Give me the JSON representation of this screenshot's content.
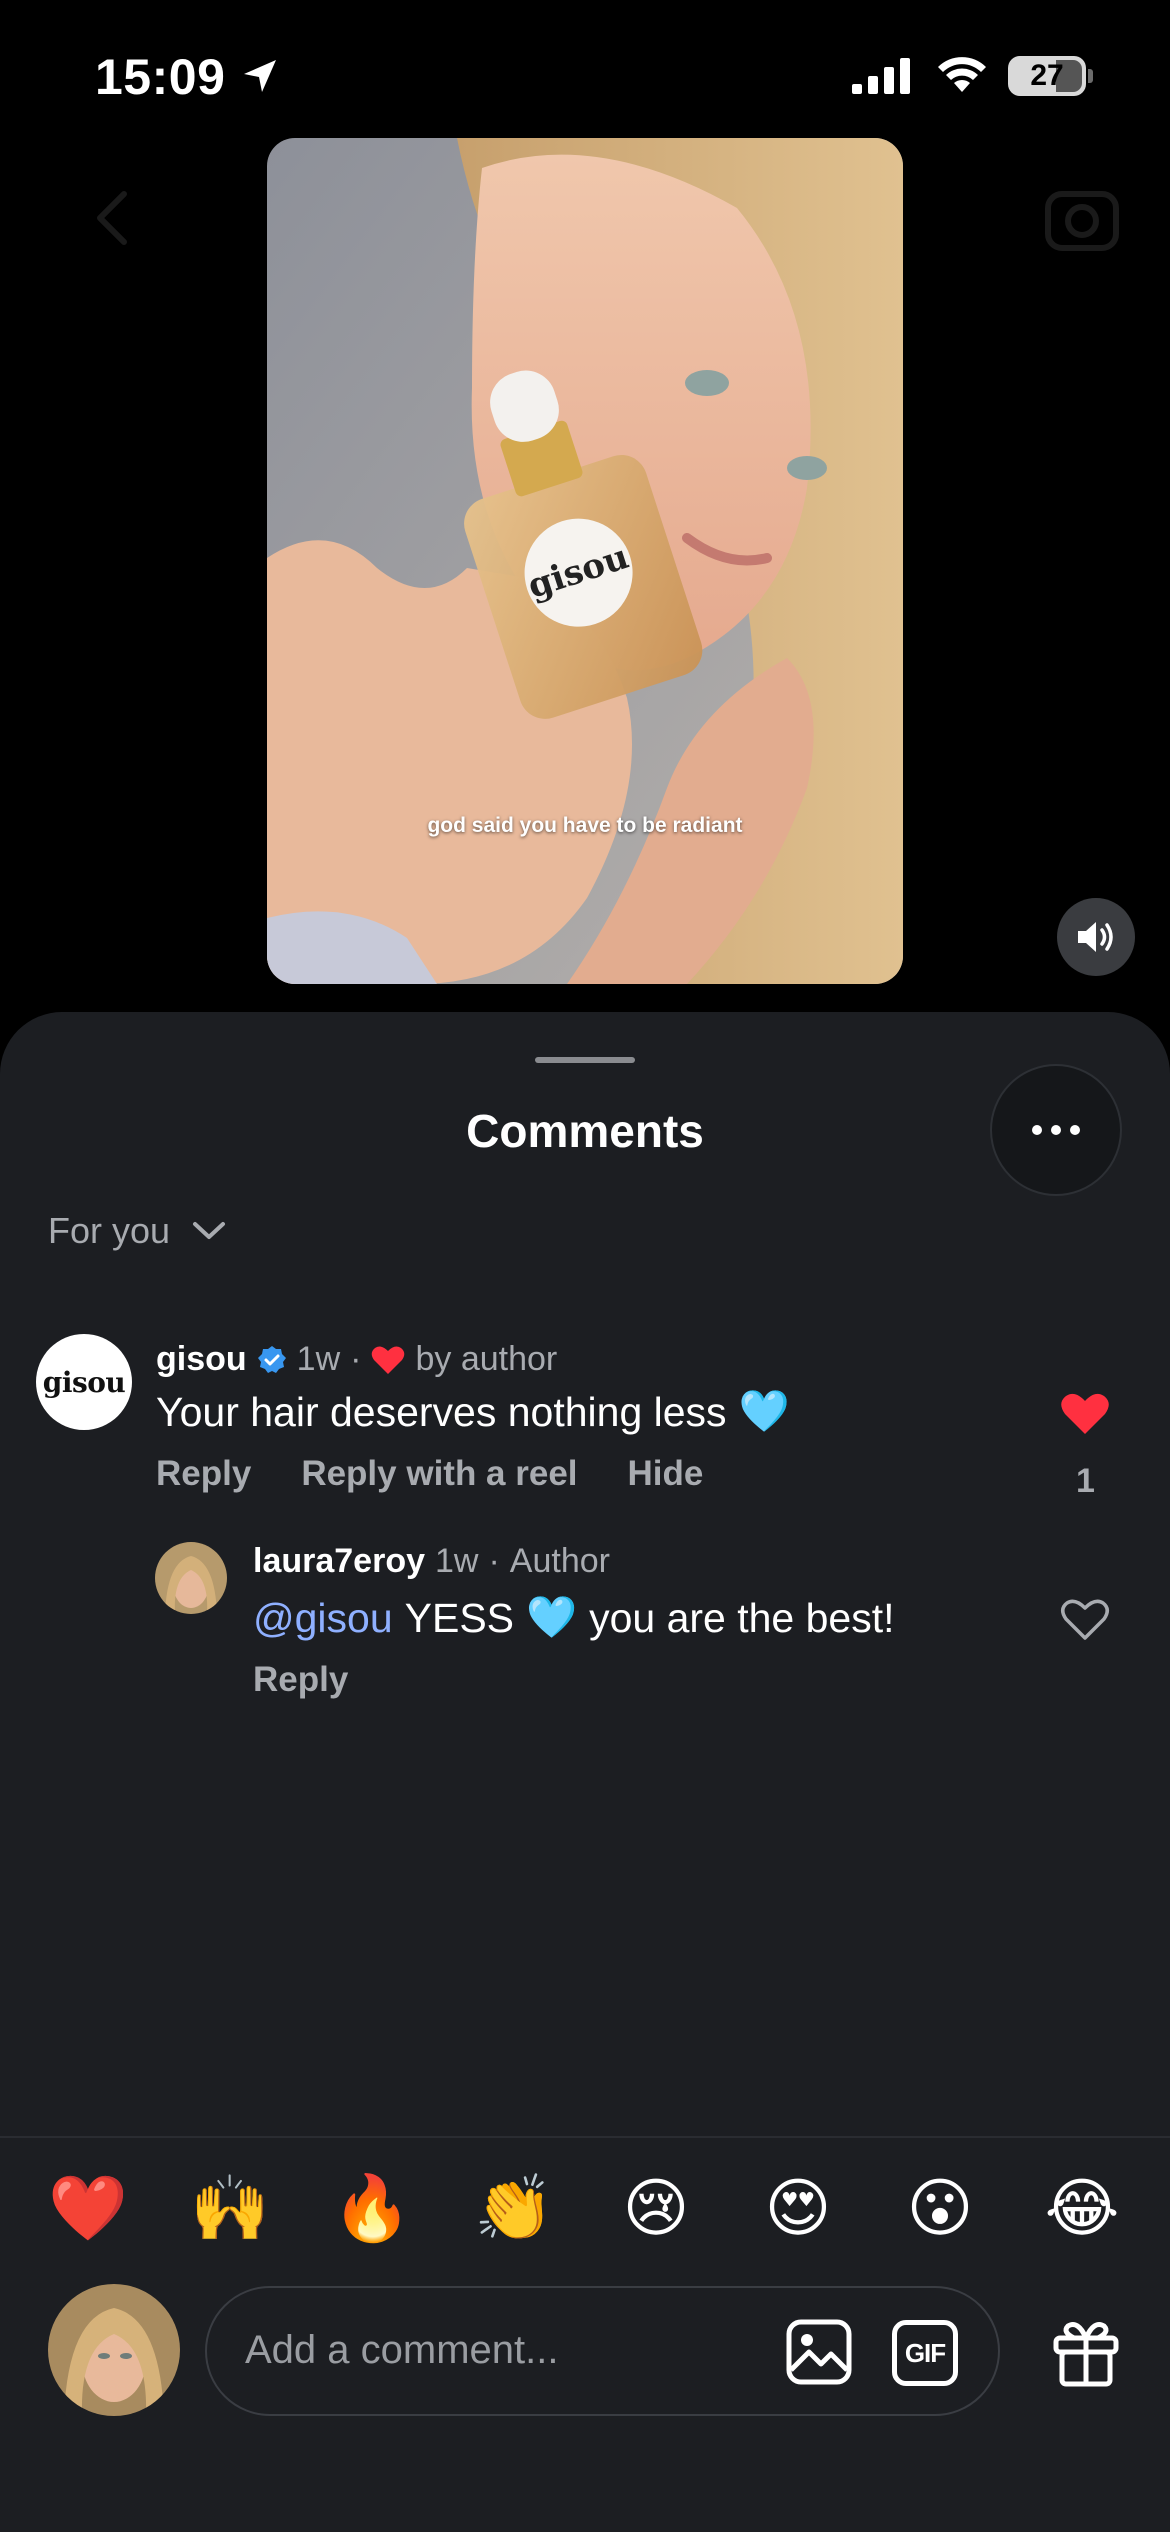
{
  "status_bar": {
    "time": "15:09",
    "battery": "27"
  },
  "video": {
    "caption": "god said you have to be radiant",
    "product_label": "gisou"
  },
  "sheet": {
    "title": "Comments",
    "filter_label": "For you"
  },
  "comments": [
    {
      "avatar_text": "gisou",
      "username": "gisou",
      "time": "1w",
      "separator": "·",
      "author_like_text": "by author",
      "text": "Your hair deserves nothing less",
      "emoji": "🩵",
      "actions": [
        "Reply",
        "Reply with a reel",
        "Hide"
      ],
      "like_count": "1",
      "liked": true
    },
    {
      "username": "laura7eroy",
      "time": "1w",
      "separator": "·",
      "role": "Author",
      "mention": "@gisou",
      "text_before": "YESS",
      "emoji": "🩵",
      "text_after": "you are the best!",
      "actions": [
        "Reply"
      ],
      "liked": false
    }
  ],
  "quick_emojis": [
    "❤️",
    "🙌",
    "🔥",
    "👏",
    "😢",
    "😍",
    "😮",
    "😂"
  ],
  "composer": {
    "placeholder": "Add a comment...",
    "gif_label": "GIF"
  },
  "colors": {
    "accent_like": "#ff3040",
    "mention": "#8fb0ff",
    "verified": "#3897f0",
    "sheet_bg": "#1c1e22"
  }
}
